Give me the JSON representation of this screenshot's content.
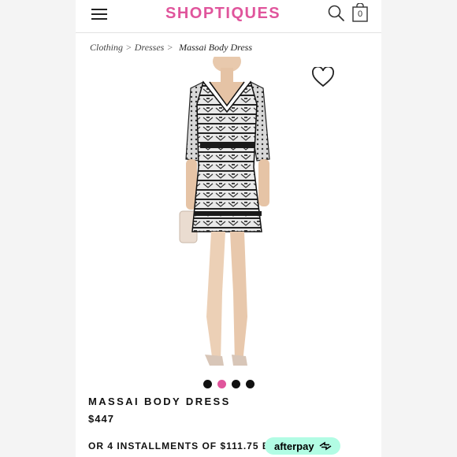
{
  "header": {
    "logo": "SHOPTIQUES",
    "cart_count": "0"
  },
  "breadcrumb": {
    "items": [
      "Clothing",
      "Dresses"
    ],
    "separator": ">",
    "current": "Massai Body Dress"
  },
  "gallery": {
    "dots": 4,
    "active_dot": 1,
    "dot_color": "#111111",
    "active_color": "#e0559c"
  },
  "product": {
    "title": "MASSAI BODY DRESS",
    "price": "$447"
  },
  "payment": {
    "installments_text": "OR 4 INSTALLMENTS OF $111.75 BY",
    "provider": "afterpay",
    "provider_color": "#b2fce4"
  },
  "colors": {
    "brand": "#e0559c"
  }
}
